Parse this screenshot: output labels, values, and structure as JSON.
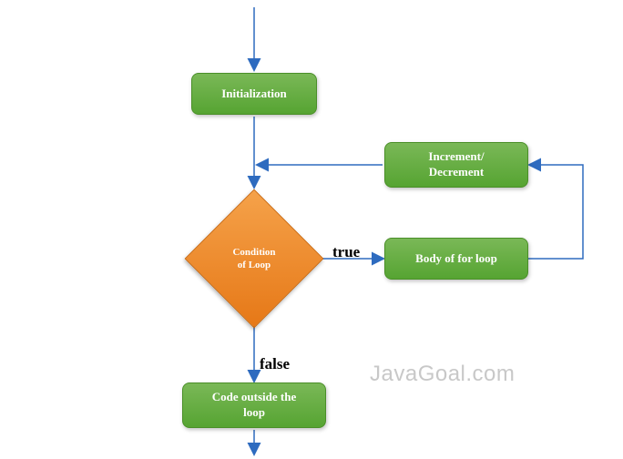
{
  "nodes": {
    "init": "Initialization",
    "incdec_line1": "Increment/",
    "incdec_line2": "Decrement",
    "condition_line1": "Condition",
    "condition_line2": "of Loop",
    "body": "Body of for loop",
    "outside_line1": "Code outside the",
    "outside_line2": "loop"
  },
  "labels": {
    "true": "true",
    "false": "false"
  },
  "watermark": "JavaGoal.com",
  "colors": {
    "arrow": "#2e6bbf",
    "green_box": "#5ca939",
    "diamond": "#ea8426"
  }
}
